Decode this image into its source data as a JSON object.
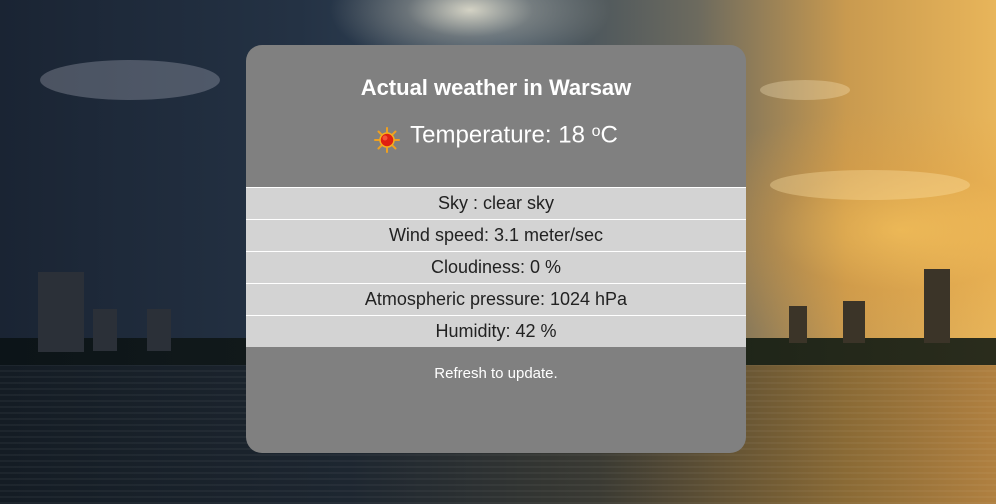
{
  "card": {
    "title": "Actual weather in Warsaw",
    "temperature_label": "Temperature: 18 ",
    "temperature_unit_degree": "o",
    "temperature_unit": "C",
    "weather_icon": "sun-icon"
  },
  "details": [
    {
      "label": "Sky : clear sky"
    },
    {
      "label": "Wind speed: 3.1 meter/sec"
    },
    {
      "label": "Cloudiness: 0 %"
    },
    {
      "label": "Atmospheric pressure: 1024 hPa"
    },
    {
      "label": "Humidity: 42 %"
    }
  ],
  "footer": {
    "refresh_text": "Refresh to update."
  },
  "colors": {
    "card_background": "#808080",
    "row_background": "#d3d3d3",
    "title_text": "#ffffff"
  }
}
